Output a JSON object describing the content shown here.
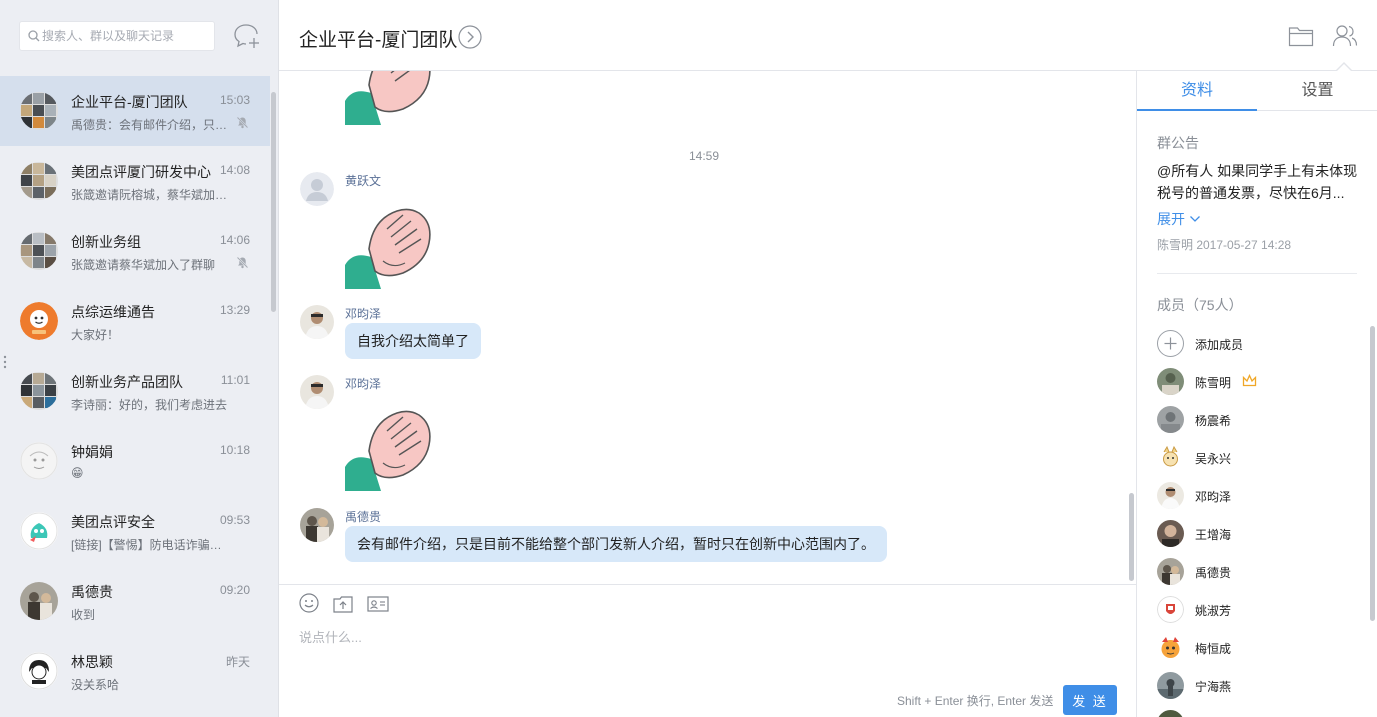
{
  "search": {
    "placeholder": "搜索人、群以及聊天记录"
  },
  "conversations": [
    {
      "name": "企业平台-厦门团队",
      "time": "15:03",
      "preview": "禹德贵：会有邮件介绍，只是目前不能给整个部门发新人介绍",
      "muted": true,
      "active": true
    },
    {
      "name": "美团点评厦门研发中心",
      "time": "14:08",
      "preview": "张箴邀请阮榕城，蔡华斌加入了群聊",
      "muted": false
    },
    {
      "name": "创新业务组",
      "time": "14:06",
      "preview": "张箴邀请蔡华斌加入了群聊",
      "muted": true
    },
    {
      "name": "点综运维通告",
      "time": "13:29",
      "preview": "大家好！",
      "muted": false
    },
    {
      "name": "创新业务产品团队",
      "time": "11:01",
      "preview": "李诗丽：好的，我们考虑进去",
      "muted": false
    },
    {
      "name": "钟娟娟",
      "time": "10:18",
      "preview": "😁",
      "muted": false
    },
    {
      "name": "美团点评安全",
      "time": "09:53",
      "preview": "[链接]【警惕】防电话诈骗紧急通知",
      "muted": false
    },
    {
      "name": "禹德贵",
      "time": "09:20",
      "preview": "收到",
      "muted": false
    },
    {
      "name": "林思颖",
      "time": "昨天",
      "preview": "没关系哈",
      "muted": false
    }
  ],
  "header": {
    "title": "企业平台-厦门团队"
  },
  "messages": {
    "time_divider": "14:59",
    "items": [
      {
        "sender": "黄跃文",
        "type": "sticker"
      },
      {
        "sender": "邓昀泽",
        "type": "text",
        "text": "自我介绍太简单了"
      },
      {
        "sender": "邓昀泽",
        "type": "sticker"
      },
      {
        "sender": "禹德贵",
        "type": "text",
        "text": "会有邮件介绍，只是目前不能给整个部门发新人介绍，暂时只在创新中心范围内了。"
      }
    ]
  },
  "composer": {
    "placeholder": "说点什么...",
    "hint": "Shift + Enter 换行, Enter 发送",
    "send_label": "发 送"
  },
  "right_panel": {
    "tabs": {
      "info": "资料",
      "settings": "设置"
    },
    "notice_label": "群公告",
    "notice_text": "@所有人  如果同学手上有未体现税号的普通发票，尽快在6月...",
    "expand_label": "展开",
    "notice_meta": "陈雪明  2017-05-27 14:28",
    "members_label": "成员（75人）",
    "add_member_label": "添加成员",
    "members": [
      "陈雪明",
      "杨震希",
      "吴永兴",
      "邓昀泽",
      "王增海",
      "禹德贵",
      "姚淑芳",
      "梅恒成",
      "宁海燕"
    ]
  },
  "colors": {
    "accent": "#3f8ee7",
    "bubble": "#d7e8f9",
    "active_conv": "#d5dfed",
    "sidebar_bg": "#eceef3"
  }
}
